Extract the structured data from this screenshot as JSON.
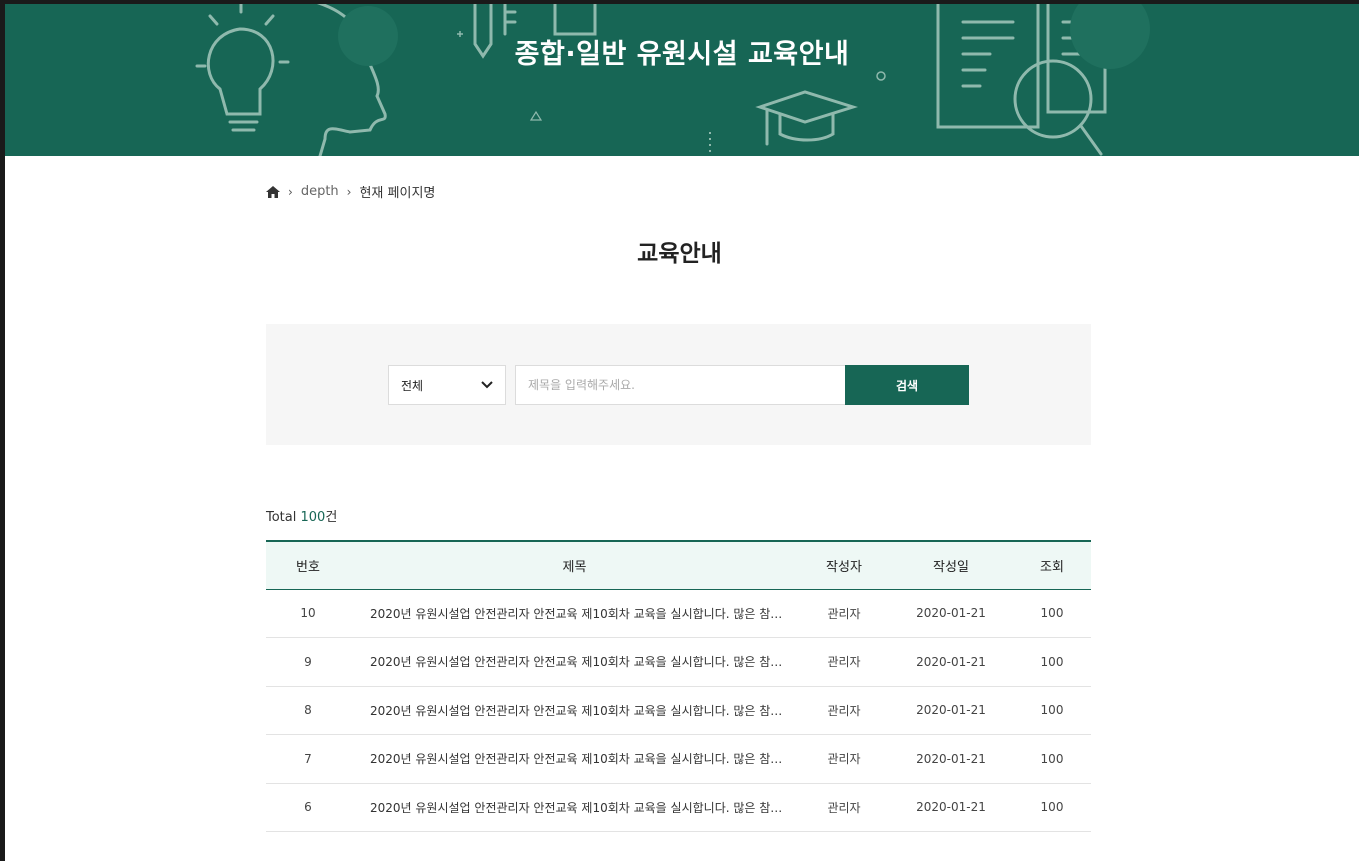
{
  "banner": {
    "title": "종합·일반 유원시설 교육안내"
  },
  "breadcrumb": {
    "home_icon": "home-icon",
    "depth": "depth",
    "current": "현재 페이지명"
  },
  "page": {
    "title": "교육안내"
  },
  "search": {
    "category_value": "전체",
    "placeholder": "제목을 입력해주세요.",
    "button_label": "검색"
  },
  "total": {
    "prefix": "Total ",
    "count": "100",
    "suffix": "건"
  },
  "table": {
    "headers": [
      "번호",
      "제목",
      "작성자",
      "작성일",
      "조회"
    ],
    "rows": [
      {
        "num": "10",
        "title": "2020년 유원시설업 안전관리자 안전교육 제10회차 교육을 실시합니다. 많은 참…",
        "author": "관리자",
        "date": "2020-01-21",
        "views": "100"
      },
      {
        "num": "9",
        "title": "2020년 유원시설업 안전관리자 안전교육 제10회차 교육을 실시합니다. 많은 참…",
        "author": "관리자",
        "date": "2020-01-21",
        "views": "100"
      },
      {
        "num": "8",
        "title": "2020년 유원시설업 안전관리자 안전교육 제10회차 교육을 실시합니다. 많은 참…",
        "author": "관리자",
        "date": "2020-01-21",
        "views": "100"
      },
      {
        "num": "7",
        "title": "2020년 유원시설업 안전관리자 안전교육 제10회차 교육을 실시합니다. 많은 참…",
        "author": "관리자",
        "date": "2020-01-21",
        "views": "100"
      },
      {
        "num": "6",
        "title": "2020년 유원시설업 안전관리자 안전교육 제10회차 교육을 실시합니다. 많은 참…",
        "author": "관리자",
        "date": "2020-01-21",
        "views": "100"
      }
    ]
  },
  "colors": {
    "brand": "#176655",
    "header_bg": "#eef8f5",
    "search_bg": "#f6f6f6"
  }
}
